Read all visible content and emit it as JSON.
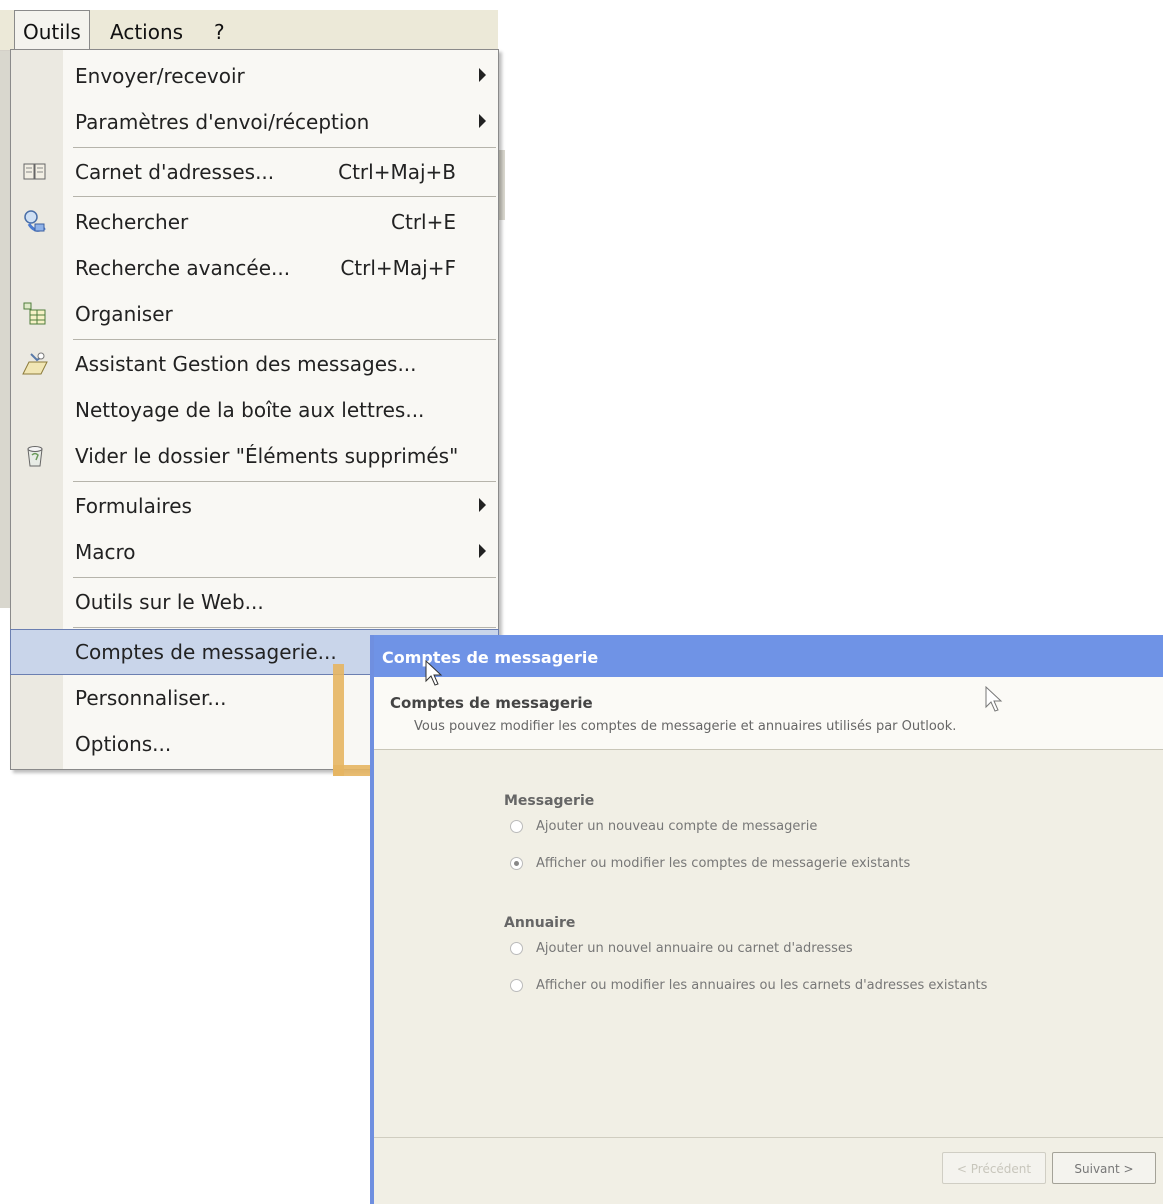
{
  "menubar": {
    "items": [
      {
        "label": "Outils"
      },
      {
        "label": "Actions"
      },
      {
        "label": "?"
      }
    ]
  },
  "menu": {
    "items": [
      {
        "label": "Envoyer/recevoir",
        "shortcut": "",
        "submenu": true,
        "icon": ""
      },
      {
        "label": "Paramètres d'envoi/réception",
        "shortcut": "",
        "submenu": true,
        "icon": ""
      },
      {
        "label": "Carnet d'adresses...",
        "shortcut": "Ctrl+Maj+B",
        "submenu": false,
        "icon": "address-book-icon"
      },
      {
        "label": "Rechercher",
        "shortcut": "Ctrl+E",
        "submenu": false,
        "icon": "search-icon"
      },
      {
        "label": "Recherche avancée...",
        "shortcut": "Ctrl+Maj+F",
        "submenu": false,
        "icon": ""
      },
      {
        "label": "Organiser",
        "shortcut": "",
        "submenu": false,
        "icon": "organize-icon"
      },
      {
        "label": "Assistant Gestion des messages...",
        "shortcut": "",
        "submenu": false,
        "icon": "rules-wizard-icon"
      },
      {
        "label": "Nettoyage de la boîte aux lettres...",
        "shortcut": "",
        "submenu": false,
        "icon": ""
      },
      {
        "label": "Vider le dossier \"Éléments supprimés\"",
        "shortcut": "",
        "submenu": false,
        "icon": "trash-icon"
      },
      {
        "label": "Formulaires",
        "shortcut": "",
        "submenu": true,
        "icon": ""
      },
      {
        "label": "Macro",
        "shortcut": "",
        "submenu": true,
        "icon": ""
      },
      {
        "label": "Outils sur le Web...",
        "shortcut": "",
        "submenu": false,
        "icon": ""
      },
      {
        "label": "Comptes de messagerie...",
        "shortcut": "",
        "submenu": false,
        "icon": "",
        "highlighted": true
      },
      {
        "label": "Personnaliser...",
        "shortcut": "",
        "submenu": false,
        "icon": ""
      },
      {
        "label": "Options...",
        "shortcut": "",
        "submenu": false,
        "icon": ""
      }
    ]
  },
  "dialog": {
    "title": "Comptes de messagerie",
    "header_title": "Comptes de messagerie",
    "header_subtitle": "Vous pouvez modifier les comptes de messagerie et annuaires utilisés par Outlook.",
    "messagerie": {
      "title": "Messagerie",
      "options": [
        {
          "label": "Ajouter un nouveau compte de messagerie",
          "checked": false
        },
        {
          "label": "Afficher ou modifier les comptes de messagerie existants",
          "checked": true
        }
      ]
    },
    "annuaire": {
      "title": "Annuaire",
      "options": [
        {
          "label": "Ajouter un nouvel annuaire ou carnet d'adresses",
          "checked": false
        },
        {
          "label": "Afficher ou modifier les annuaires ou les carnets d'adresses existants",
          "checked": false
        }
      ]
    },
    "buttons": {
      "previous": "< Précédent",
      "next": "Suivant >"
    }
  },
  "colors": {
    "titlebar": "#6f93e6",
    "highlight": "#c9d5ea",
    "arrow": "#e6b562"
  }
}
